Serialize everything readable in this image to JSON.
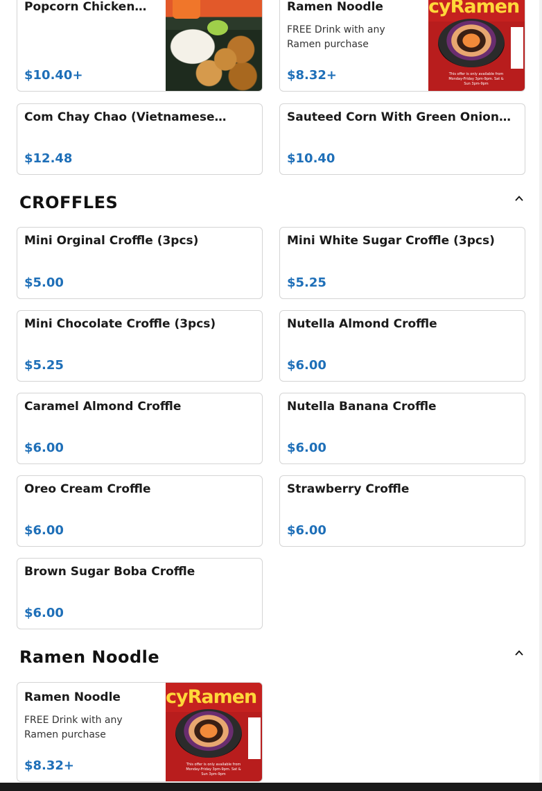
{
  "top_items": [
    {
      "name": "Popcorn Chicken…",
      "price": "$10.40+"
    },
    {
      "name": "Ramen Noodle",
      "description": "FREE Drink with any Ramen purchase",
      "price": "$8.32+"
    },
    {
      "name": "Com Chay Chao (Vietnamese…",
      "price": "$12.48"
    },
    {
      "name": "Sauteed Corn With Green Onion…",
      "price": "$10.40"
    }
  ],
  "sections": [
    {
      "title": "CROFFLES",
      "items": [
        {
          "name": "Mini Orginal Croffle (3pcs)",
          "price": "$5.00"
        },
        {
          "name": "Mini White Sugar Croffle (3pcs)",
          "price": "$5.25"
        },
        {
          "name": "Mini Chocolate Croffle (3pcs)",
          "price": "$5.25"
        },
        {
          "name": "Nutella Almond Croffle",
          "price": "$6.00"
        },
        {
          "name": "Caramel Almond Croffle",
          "price": "$6.00"
        },
        {
          "name": "Nutella Banana Croffle",
          "price": "$6.00"
        },
        {
          "name": "Oreo Cream Croffle",
          "price": "$6.00"
        },
        {
          "name": "Strawberry Croffle",
          "price": "$6.00"
        },
        {
          "name": "Brown Sugar Boba Croffle",
          "price": "$6.00"
        }
      ]
    },
    {
      "title": "Ramen Noodle",
      "items": [
        {
          "name": "Ramen Noodle",
          "description": "FREE Drink with any Ramen purchase",
          "price": "$8.32+"
        }
      ]
    }
  ],
  "ramen_image": {
    "banner_text": "cyRamen Noo",
    "fine_print": "This offer is only available from Monday-Friday 3pm-9pm. Sat & Sun 3pm-9pm"
  },
  "icons": {
    "collapse": "chevron-up-icon"
  },
  "colors": {
    "price": "#1e6fb8",
    "card_border": "#d4d4d4"
  }
}
